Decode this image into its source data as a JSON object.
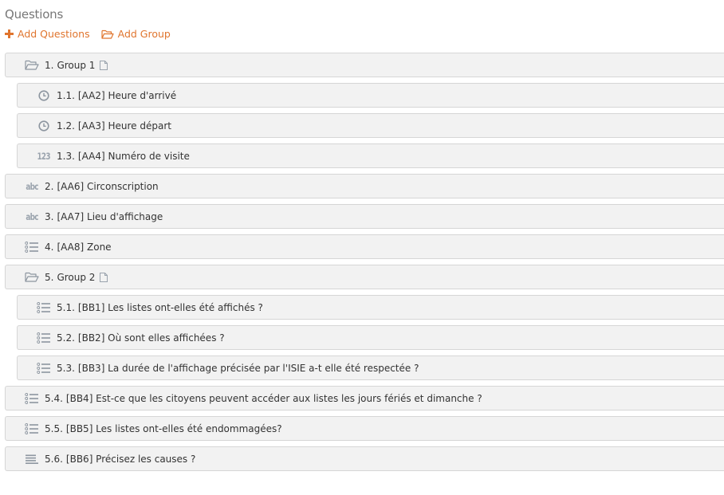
{
  "header": {
    "title": "Questions",
    "add_questions": "Add Questions",
    "add_group": "Add Group"
  },
  "accent": "#e0752e",
  "items": [
    {
      "num": "1.",
      "label": "Group 1",
      "icon": "folder-open-icon",
      "level": 0,
      "doc": true
    },
    {
      "num": "1.1.",
      "label": "[AA2] Heure d'arrivé",
      "icon": "clock-icon",
      "level": 1
    },
    {
      "num": "1.2.",
      "label": "[AA3] Heure départ",
      "icon": "clock-icon",
      "level": 1
    },
    {
      "num": "1.3.",
      "label": "[AA4] Numéro de visite",
      "icon": "number-icon",
      "icon_text": "123",
      "level": 1
    },
    {
      "num": "2.",
      "label": "[AA6] Circonscription",
      "icon": "text-icon",
      "icon_text": "abc",
      "level": 0
    },
    {
      "num": "3.",
      "label": "[AA7] Lieu d'affichage",
      "icon": "text-icon",
      "icon_text": "abc",
      "level": 0
    },
    {
      "num": "4.",
      "label": "[AA8] Zone",
      "icon": "list-icon",
      "level": 0
    },
    {
      "num": "5.",
      "label": "Group 2",
      "icon": "folder-open-icon",
      "level": 0,
      "doc": true
    },
    {
      "num": "5.1.",
      "label": "[BB1] Les listes ont-elles été affichés ?",
      "icon": "list-icon",
      "level": 1
    },
    {
      "num": "5.2.",
      "label": "[BB2] Où sont elles affichées ?",
      "icon": "list-icon",
      "level": 1
    },
    {
      "num": "5.3.",
      "label": "[BB3] La durée de l'affichage précisée par l'ISIE a-t elle été respectée ?",
      "icon": "list-icon",
      "level": 1
    },
    {
      "num": "5.4.",
      "label": "[BB4] Est-ce que les citoyens peuvent accéder aux listes les jours fériés et dimanche ?",
      "icon": "list-icon",
      "level": 0
    },
    {
      "num": "5.5.",
      "label": "[BB5] Les listes ont-elles été endommagées?",
      "icon": "list-icon",
      "level": 0
    },
    {
      "num": "5.6.",
      "label": "[BB6] Précisez les causes ?",
      "icon": "paragraph-icon",
      "level": 0
    }
  ]
}
